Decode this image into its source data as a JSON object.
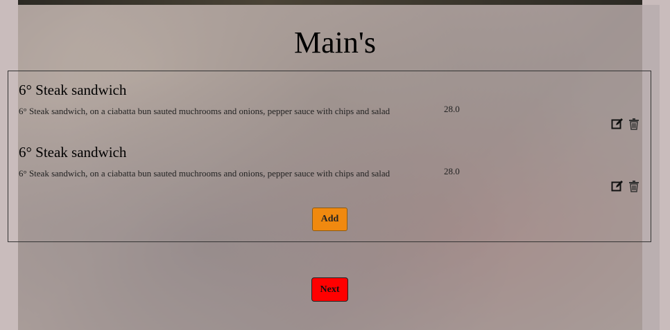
{
  "page": {
    "title": "Main's"
  },
  "items": [
    {
      "name": "6° Steak sandwich",
      "description": "6° Steak sandwich, on a ciabatta bun sauted muchrooms and onions, pepper sauce with chips and salad",
      "price": "28.0"
    },
    {
      "name": "6° Steak sandwich",
      "description": "6° Steak sandwich, on a ciabatta bun sauted muchrooms and onions, pepper sauce with chips and salad",
      "price": "28.0"
    }
  ],
  "actions": {
    "add_label": "Add",
    "next_label": "Next"
  },
  "colors": {
    "add_button": "#f0890f",
    "next_button": "#ff0000"
  },
  "icons": {
    "edit": "edit-icon",
    "delete": "trash-icon"
  }
}
